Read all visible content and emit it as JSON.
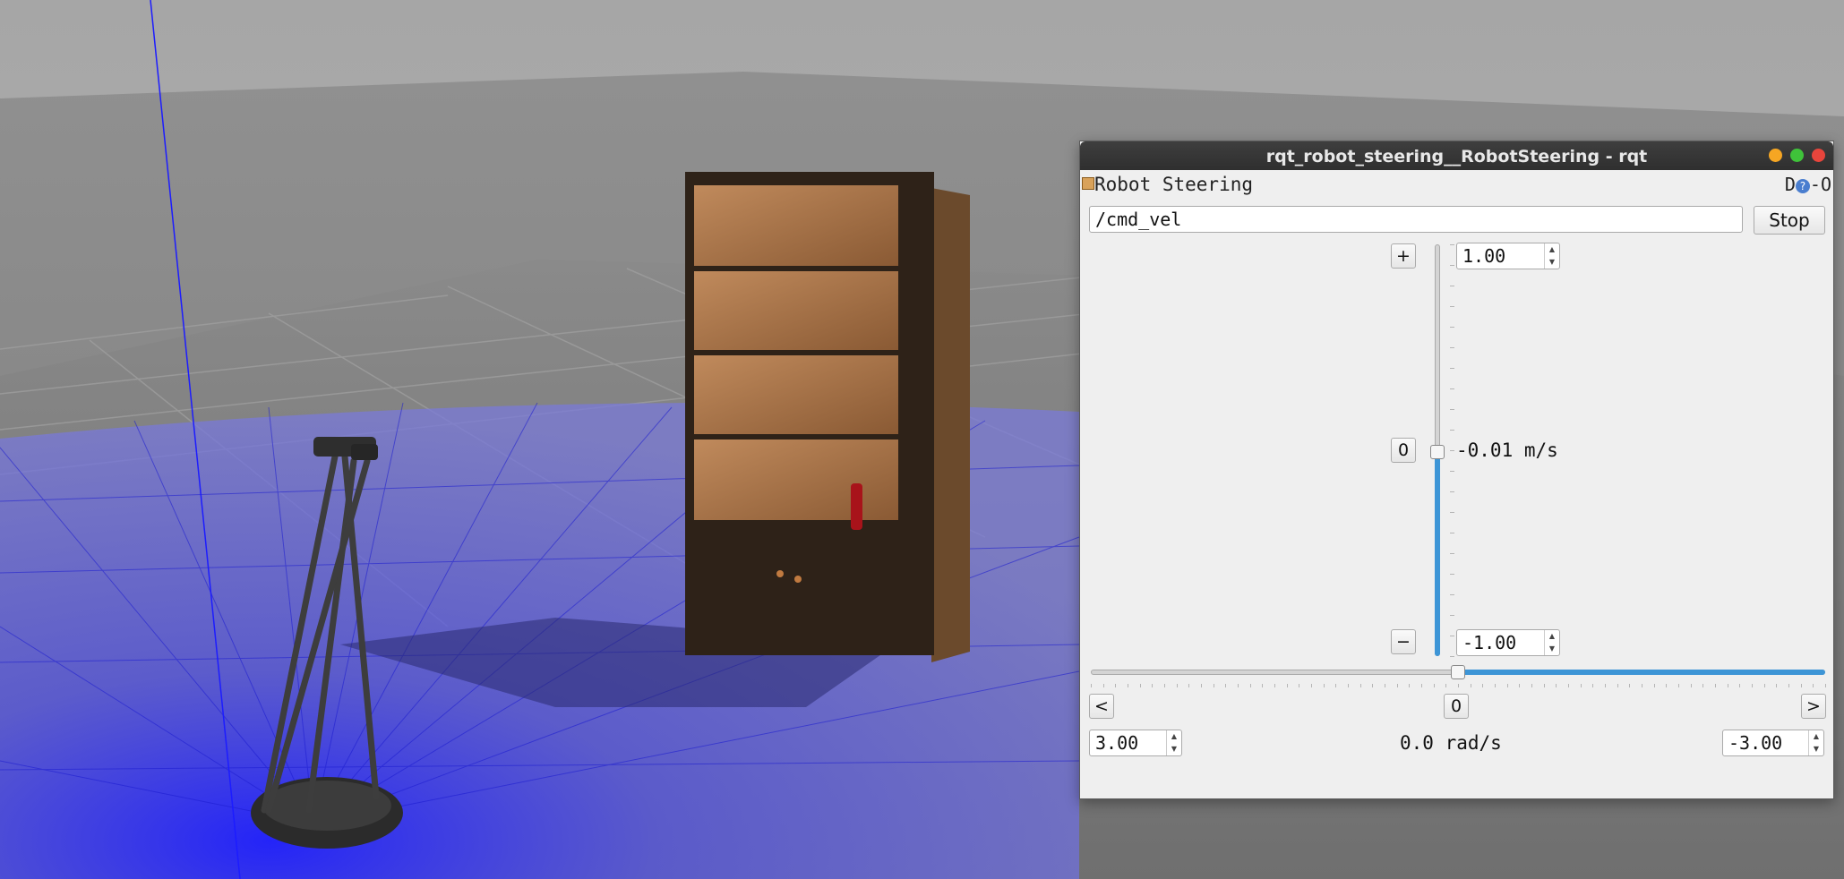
{
  "window": {
    "title": "rqt_robot_steering__RobotSteering - rqt",
    "plugin_title": "Robot Steering",
    "plugin_controls": "D",
    "plugin_controls_suffix": "-O",
    "help_glyph": "?"
  },
  "topic": {
    "value": "/cmd_vel"
  },
  "stop_label": "Stop",
  "linear": {
    "increase_label": "+",
    "reset_label": "0",
    "decrease_label": "−",
    "max": "1.00",
    "min": "-1.00",
    "current_display": "-0.01 m/s",
    "current_value": -0.01
  },
  "angular": {
    "left_label": "<",
    "reset_label": "0",
    "right_label": ">",
    "max": "3.00",
    "min": "-3.00",
    "current_display": "0.0 rad/s",
    "current_value": 0.0
  },
  "colors": {
    "slider_fill": "#3d95d6",
    "laser": "#2a2ee0",
    "close": "#e8453c",
    "minimize": "#f6a623",
    "maximize": "#3fc23a"
  }
}
